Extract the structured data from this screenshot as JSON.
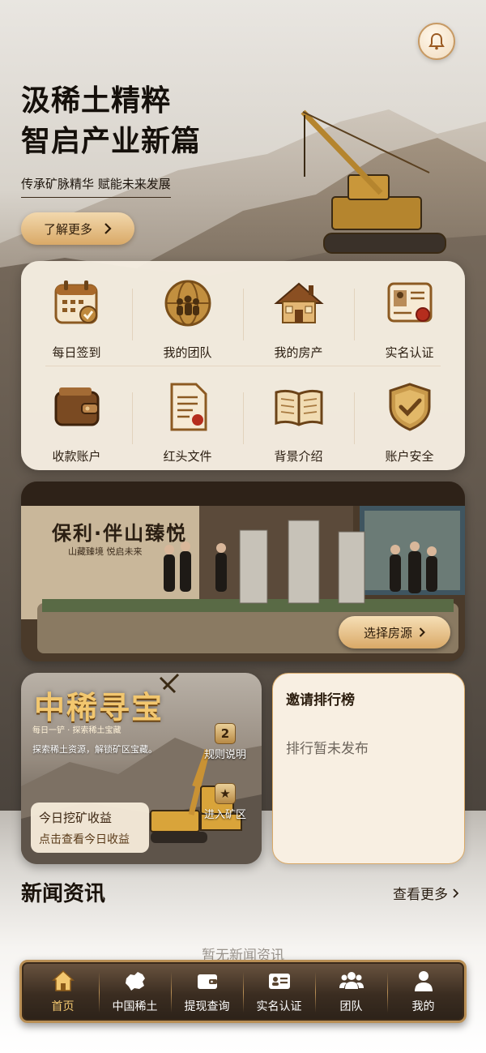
{
  "hero": {
    "title_line1": "汲稀土精粹",
    "title_line2": "智启产业新篇",
    "subtitle": "传承矿脉精华 赋能未来发展",
    "learn_more": "了解更多"
  },
  "grid": {
    "items": [
      {
        "label": "每日签到",
        "icon": "calendar-check-icon"
      },
      {
        "label": "我的团队",
        "icon": "team-globe-icon"
      },
      {
        "label": "我的房产",
        "icon": "house-icon"
      },
      {
        "label": "实名认证",
        "icon": "id-card-icon"
      },
      {
        "label": "收款账户",
        "icon": "wallet-icon"
      },
      {
        "label": "红头文件",
        "icon": "document-icon"
      },
      {
        "label": "背景介绍",
        "icon": "open-book-icon"
      },
      {
        "label": "账户安全",
        "icon": "shield-check-icon"
      }
    ]
  },
  "banner": {
    "sign": "保利·伴山臻悦",
    "sign_sub": "山藏臻境  悦启未来",
    "select_button": "选择房源"
  },
  "treasure": {
    "title": "中稀寻宝",
    "tagline": "每日一铲 · 探索稀土宝藏",
    "description": "探索稀土资源，解锁矿区宝藏。",
    "rules_badge": "2",
    "rules_label": "规则说明",
    "enter_label": "进入矿区",
    "earn_title": "今日挖矿收益",
    "earn_sub": "点击查看今日收益"
  },
  "rank": {
    "title": "邀请排行榜",
    "empty": "排行暂未发布"
  },
  "news": {
    "title": "新闻资讯",
    "more": "查看更多",
    "empty": "暂无新闻资讯"
  },
  "tabbar": {
    "items": [
      {
        "label": "首页",
        "icon": "home-icon",
        "active": true
      },
      {
        "label": "中国稀土",
        "icon": "china-map-icon",
        "active": false
      },
      {
        "label": "提现查询",
        "icon": "wallet-icon",
        "active": false
      },
      {
        "label": "实名认证",
        "icon": "id-card-icon",
        "active": false
      },
      {
        "label": "团队",
        "icon": "team-icon",
        "active": false
      },
      {
        "label": "我的",
        "icon": "user-icon",
        "active": false
      }
    ]
  },
  "colors": {
    "accent_gold": "#d9a967",
    "active_tab": "#f2c76f",
    "dark_brown": "#2c2219"
  }
}
